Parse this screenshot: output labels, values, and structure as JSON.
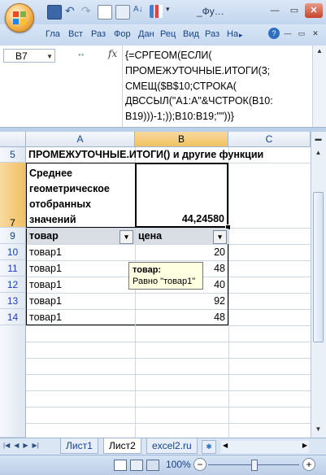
{
  "title": "_Фу…",
  "ribbon_tabs": [
    "Гла",
    "Вст",
    "Раз",
    "Фор",
    "Дан",
    "Рец",
    "Вид",
    "Раз",
    "На"
  ],
  "name_box": "B7",
  "fx_label": "fx",
  "formula": "{=СРГЕОМ(ЕСЛИ(\nПРОМЕЖУТОЧНЫЕ.ИТОГИ(3;\nСМЕЩ($B$10;СТРОКА(\nДВССЫЛ(\"A1:A\"&ЧСТРОК(B10:\nB19)))-1;));B10:B19;\"\"))}",
  "columns": [
    "A",
    "B",
    "C"
  ],
  "rows": {
    "r5": {
      "num": "5",
      "a": "ПРОМЕЖУТОЧНЫЕ.ИТОГИ() и другие функции"
    },
    "r7": {
      "num": "7",
      "a_lines": [
        "Среднее",
        "геометрическое",
        "отобранных",
        "значений"
      ],
      "b": "44,24580"
    },
    "r9": {
      "num": "9",
      "a": "товар",
      "b": "цена"
    },
    "data": [
      {
        "num": "10",
        "a": "товар1",
        "b": "20"
      },
      {
        "num": "11",
        "a": "товар1",
        "b": "48"
      },
      {
        "num": "12",
        "a": "товар1",
        "b": "40"
      },
      {
        "num": "13",
        "a": "товар1",
        "b": "92"
      },
      {
        "num": "14",
        "a": "товар1",
        "b": "48"
      }
    ]
  },
  "comment": {
    "title": "товар:",
    "text": "Равно \"товар1\""
  },
  "sheet_tabs": [
    "Лист1",
    "Лист2",
    "excel2.ru"
  ],
  "active_sheet": "Лист2",
  "zoom": "100%"
}
